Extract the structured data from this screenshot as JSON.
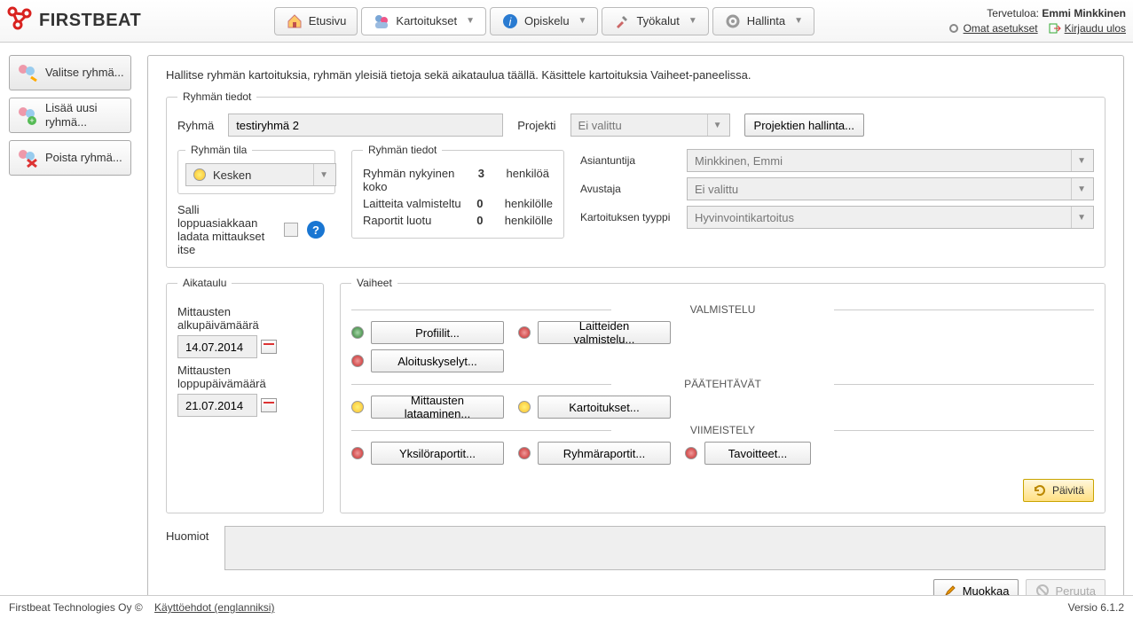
{
  "header": {
    "logo_text": "FIRSTBEAT",
    "welcome_prefix": "Tervetuloa:",
    "welcome_user": "Emmi Minkkinen",
    "settings_link": "Omat asetukset",
    "logout_link": "Kirjaudu ulos",
    "tabs": [
      {
        "label": "Etusivu"
      },
      {
        "label": "Kartoitukset"
      },
      {
        "label": "Opiskelu"
      },
      {
        "label": "Työkalut"
      },
      {
        "label": "Hallinta"
      }
    ]
  },
  "sidebar": {
    "items": [
      {
        "label": "Valitse ryhmä..."
      },
      {
        "label": "Lisää uusi ryhmä..."
      },
      {
        "label": "Poista ryhmä..."
      }
    ]
  },
  "helptext": "Hallitse ryhmän kartoituksia, ryhmän yleisiä tietoja sekä aikataulua täällä. Käsittele kartoituksia Vaiheet-paneelissa.",
  "group": {
    "legend": "Ryhmän tiedot",
    "name_label": "Ryhmä",
    "name_value": "testiryhmä 2",
    "project_label": "Projekti",
    "project_value": "Ei valittu",
    "manage_projects": "Projektien hallinta...",
    "status_legend": "Ryhmän tila",
    "status_value": "Kesken",
    "info_legend": "Ryhmän tiedot",
    "info_rows": [
      {
        "k": "Ryhmän nykyinen koko",
        "v": "3",
        "u": "henkilöä"
      },
      {
        "k": "Laitteita valmisteltu",
        "v": "0",
        "u": "henkilölle"
      },
      {
        "k": "Raportit luotu",
        "v": "0",
        "u": "henkilölle"
      }
    ],
    "right": {
      "expert_label": "Asiantuntija",
      "expert_value": "Minkkinen, Emmi",
      "assistant_label": "Avustaja",
      "assistant_value": "Ei valittu",
      "type_label": "Kartoituksen tyyppi",
      "type_value": "Hyvinvointikartoitus"
    },
    "allow_label": "Salli loppuasiakkaan ladata mittaukset itse"
  },
  "schedule": {
    "legend": "Aikataulu",
    "start_label": "Mittausten alkupäivämäärä",
    "start_value": "14.07.2014",
    "end_label": "Mittausten loppupäivämäärä",
    "end_value": "21.07.2014"
  },
  "phases": {
    "legend": "Vaiheet",
    "sections": {
      "prep": "VALMISTELU",
      "main": "PÄÄTEHTÄVÄT",
      "finish": "VIIMEISTELY"
    },
    "buttons": {
      "profiles": "Profiilit...",
      "devices": "Laitteiden valmistelu...",
      "surveys": "Aloituskyselyt...",
      "upload": "Mittausten lataaminen...",
      "assessments": "Kartoitukset...",
      "ind_reports": "Yksilöraportit...",
      "group_reports": "Ryhmäraportit...",
      "goals": "Tavoitteet..."
    },
    "refresh": "Päivitä"
  },
  "notes": {
    "label": "Huomiot"
  },
  "actions": {
    "edit": "Muokkaa",
    "cancel": "Peruuta"
  },
  "footer": {
    "company": "Firstbeat Technologies Oy ©",
    "terms": "Käyttöehdot (englanniksi)",
    "version": "Versio 6.1.2"
  }
}
